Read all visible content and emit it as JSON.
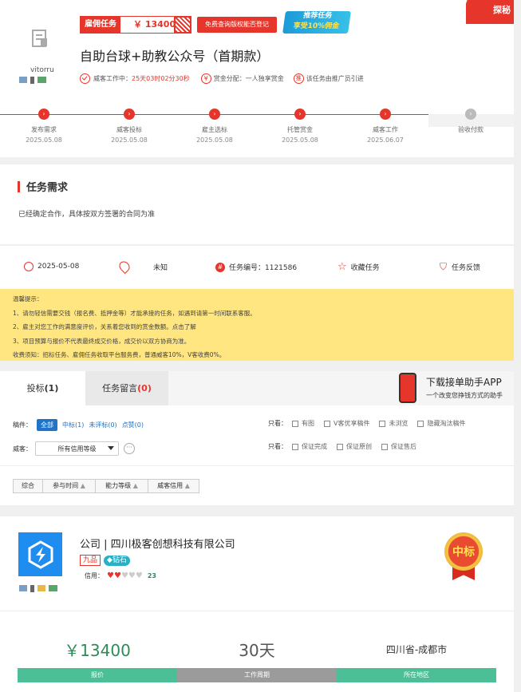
{
  "header": {
    "corner_badge": "探秘",
    "task_type": "雇佣任务",
    "price": "￥ 13400",
    "free_query_btn": "免费查询版权能否登记",
    "promo_line1": "推荐任务",
    "promo_line2": "享受10%佣金",
    "title": "自助台球+助教公众号（首期款）",
    "username": "vitorru",
    "status_label": "威客工作中：",
    "status_time": "25天03时02分30秒",
    "reward_dist": "赏金分配：一人独享赏金",
    "promoter": "该任务由推广员引进"
  },
  "steps": [
    {
      "label": "发布需求",
      "date": "2025.05.08"
    },
    {
      "label": "威客投标",
      "date": "2025.05.08"
    },
    {
      "label": "雇主选标",
      "date": "2025.05.08"
    },
    {
      "label": "托管赏金",
      "date": "2025.05.08"
    },
    {
      "label": "威客工作",
      "date": "2025.06.07"
    },
    {
      "label": "验收付款",
      "date": ""
    }
  ],
  "requirement": {
    "heading": "任务需求",
    "text": "已经确定合作，具体按双方签署的合同为准"
  },
  "meta": {
    "date": "2025-05-08",
    "location": "未知",
    "task_no": "任务编号：1121586",
    "favorite": "收藏任务",
    "feedback": "任务反馈"
  },
  "notice": {
    "title": "温馨提示：",
    "items": [
      "1、请勿轻信需要交钱（报名费、抵押金等）才能承接的任务，如遇到请第一时间联系客服。",
      "2、雇主对您工作的满意度评价，关系着您收到的赏金数额。点击了解",
      "3、项目预算与报价不代表最终成交价格，成交价以双方协商为准。",
      "收费须知：招标任务、雇佣任务收取平台服务费，普通威客10%，V客收费0%。"
    ]
  },
  "tabs": {
    "bid_label": "投标",
    "bid_count": "(1)",
    "msg_label": "任务留言",
    "msg_count": "(0)",
    "app_title": "下载接单助手APP",
    "app_sub": "一个改变您挣钱方式的助手"
  },
  "filters": {
    "manuscript_label": "稿件：",
    "manuscript_opts": [
      "全部",
      "中标(1)",
      "未评标(0)",
      "点赞(0)"
    ],
    "view_label1": "只看：",
    "view_opts1": [
      "有图",
      "V客优享稿件",
      "未浏览",
      "隐藏淘汰稿件"
    ],
    "view_label2": "只看：",
    "view_opts2": [
      "保证完成",
      "保证原创",
      "保证售后"
    ],
    "weike_label": "威客：",
    "credit_select": "所有信用等级",
    "sort": [
      "综合",
      "参与时间",
      "能力等级",
      "威客信用"
    ]
  },
  "bid": {
    "company": "公司 | 四川极客创想科技有限公司",
    "level": "九品",
    "diamond": "钻石",
    "credit_label": "信用：",
    "credit_score": "23",
    "won": "中标",
    "price": "￥13400",
    "period": "30天",
    "region": "四川省-成都市",
    "price_label": "报价",
    "period_label": "工作周期",
    "region_label": "所在地区"
  },
  "colors": {
    "red": "#e6352b",
    "green": "#4cbf96",
    "teal": "#2e8b57",
    "blue": "#1f73c9",
    "yellow": "#ffe680"
  }
}
